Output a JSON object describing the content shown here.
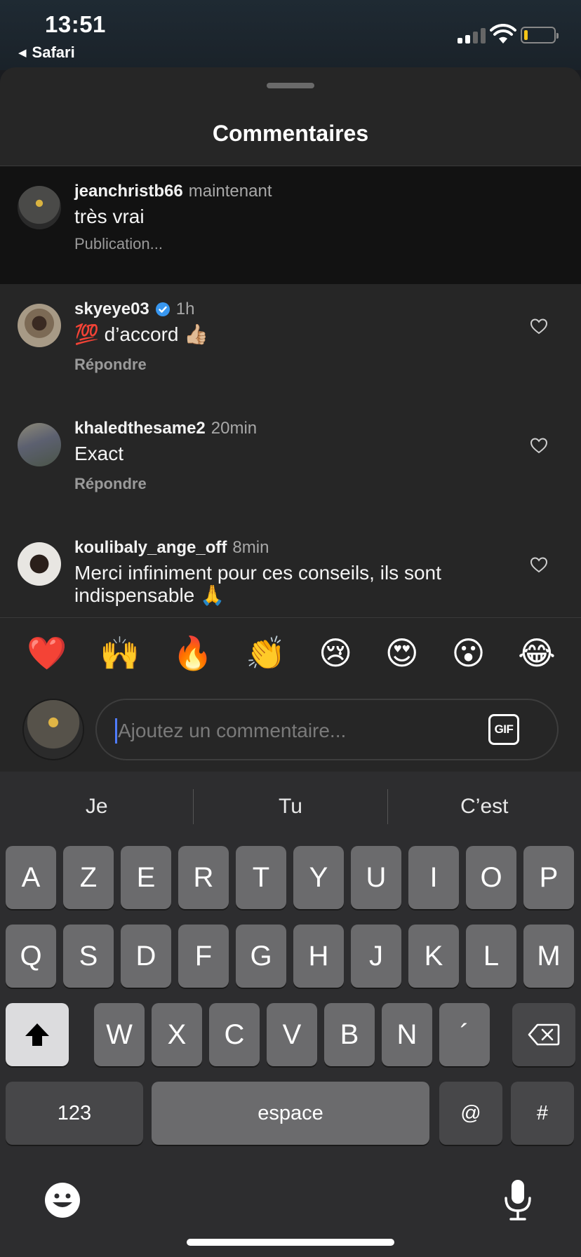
{
  "status_bar": {
    "time": "13:51",
    "back_app": "Safari"
  },
  "sheet": {
    "title": "Commentaires"
  },
  "comments": [
    {
      "username": "jeanchristb66",
      "time": "maintenant",
      "text": "très vrai",
      "status": "Publication..."
    },
    {
      "username": "skyeye03",
      "verified": true,
      "time": "1h",
      "text": "💯 d’accord 👍🏼",
      "reply_label": "Répondre"
    },
    {
      "username": "khaledthesame2",
      "time": "20min",
      "text": "Exact",
      "reply_label": "Répondre"
    },
    {
      "username": "koulibaly_ange_off",
      "time": "8min",
      "text": "Merci infiniment pour ces conseils, ils sont indispensable 🙏"
    }
  ],
  "emoji_bar": [
    "❤️",
    "🙌",
    "🔥",
    "👏",
    "😢",
    "😍",
    "😮",
    "😂"
  ],
  "composer": {
    "placeholder": "Ajoutez un commentaire...",
    "gif_label": "GIF"
  },
  "keyboard": {
    "predictions": [
      "Je",
      "Tu",
      "C’est"
    ],
    "row1": [
      "A",
      "Z",
      "E",
      "R",
      "T",
      "Y",
      "U",
      "I",
      "O",
      "P"
    ],
    "row2": [
      "Q",
      "S",
      "D",
      "F",
      "G",
      "H",
      "J",
      "K",
      "L",
      "M"
    ],
    "row3": [
      "W",
      "X",
      "C",
      "V",
      "B",
      "N",
      "´"
    ],
    "numbers_label": "123",
    "space_label": "espace",
    "at_label": "@",
    "hash_label": "#"
  },
  "colors": {
    "verified_blue": "#3897f0",
    "caret": "#4f7cff",
    "battery": "#f5c518"
  }
}
